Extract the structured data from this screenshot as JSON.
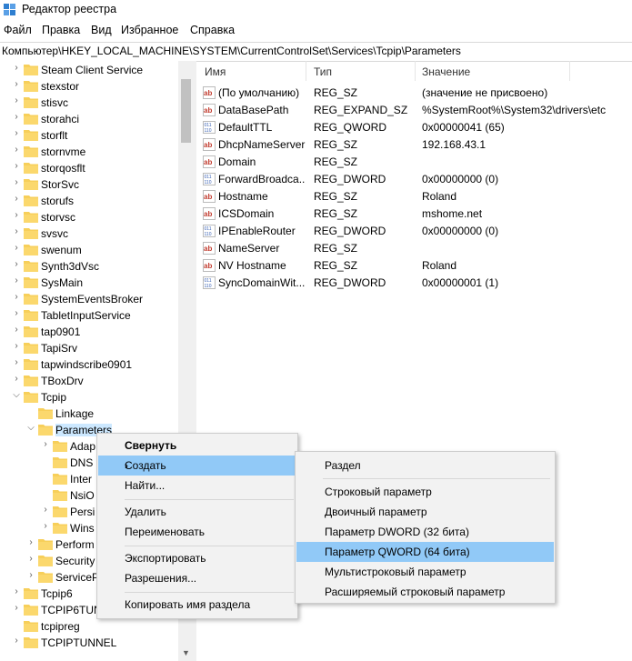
{
  "window": {
    "title": "Редактор реестра"
  },
  "menu": [
    "Файл",
    "Правка",
    "Вид",
    "Избранное",
    "Справка"
  ],
  "address": "Компьютер\\HKEY_LOCAL_MACHINE\\SYSTEM\\CurrentControlSet\\Services\\Tcpip\\Parameters",
  "tree": {
    "items": [
      {
        "label": "Steam Client Service"
      },
      {
        "label": "stexstor"
      },
      {
        "label": "stisvc"
      },
      {
        "label": "storahci"
      },
      {
        "label": "storflt"
      },
      {
        "label": "stornvme"
      },
      {
        "label": "storqosflt"
      },
      {
        "label": "StorSvc"
      },
      {
        "label": "storufs"
      },
      {
        "label": "storvsc"
      },
      {
        "label": "svsvc"
      },
      {
        "label": "swenum"
      },
      {
        "label": "Synth3dVsc"
      },
      {
        "label": "SysMain"
      },
      {
        "label": "SystemEventsBroker"
      },
      {
        "label": "TabletInputService"
      },
      {
        "label": "tap0901"
      },
      {
        "label": "TapiSrv"
      },
      {
        "label": "tapwindscribe0901"
      },
      {
        "label": "TBoxDrv"
      },
      {
        "label": "Tcpip"
      },
      {
        "label": "Linkage"
      },
      {
        "label": "Parameters"
      },
      {
        "label": "Adap"
      },
      {
        "label": "DNS"
      },
      {
        "label": "Inter"
      },
      {
        "label": "NsiO"
      },
      {
        "label": "Persi"
      },
      {
        "label": "Wins"
      },
      {
        "label": "Perform"
      },
      {
        "label": "Security"
      },
      {
        "label": "ServiceP"
      },
      {
        "label": "Tcpip6"
      },
      {
        "label": "TCPIP6TUN"
      },
      {
        "label": "tcpipreg"
      },
      {
        "label": "TCPIPTUNNEL"
      }
    ]
  },
  "list": {
    "headers": [
      "Имя",
      "Тип",
      "Значение"
    ],
    "rows": [
      {
        "name": "(По умолчанию)",
        "type": "REG_SZ",
        "value": "(значение не присвоено)",
        "icon": "string-value-icon"
      },
      {
        "name": "DataBasePath",
        "type": "REG_EXPAND_SZ",
        "value": "%SystemRoot%\\System32\\drivers\\etc",
        "icon": "string-value-icon"
      },
      {
        "name": "DefaultTTL",
        "type": "REG_QWORD",
        "value": "0x00000041 (65)",
        "icon": "binary-value-icon"
      },
      {
        "name": "DhcpNameServer",
        "type": "REG_SZ",
        "value": "192.168.43.1",
        "icon": "string-value-icon"
      },
      {
        "name": "Domain",
        "type": "REG_SZ",
        "value": "",
        "icon": "string-value-icon"
      },
      {
        "name": "ForwardBroadca...",
        "type": "REG_DWORD",
        "value": "0x00000000 (0)",
        "icon": "binary-value-icon"
      },
      {
        "name": "Hostname",
        "type": "REG_SZ",
        "value": "Roland",
        "icon": "string-value-icon"
      },
      {
        "name": "ICSDomain",
        "type": "REG_SZ",
        "value": "mshome.net",
        "icon": "string-value-icon"
      },
      {
        "name": "IPEnableRouter",
        "type": "REG_DWORD",
        "value": "0x00000000 (0)",
        "icon": "binary-value-icon"
      },
      {
        "name": "NameServer",
        "type": "REG_SZ",
        "value": "",
        "icon": "string-value-icon"
      },
      {
        "name": "NV Hostname",
        "type": "REG_SZ",
        "value": "Roland",
        "icon": "string-value-icon"
      },
      {
        "name": "SyncDomainWit...",
        "type": "REG_DWORD",
        "value": "0x00000001 (1)",
        "icon": "binary-value-icon"
      }
    ]
  },
  "context_menu": {
    "items": [
      "Свернуть",
      "Создать",
      "Найти...",
      "Удалить",
      "Переименовать",
      "Экспортировать",
      "Разрешения...",
      "Копировать имя раздела"
    ]
  },
  "submenu": {
    "items": [
      "Раздел",
      "Строковый параметр",
      "Двоичный параметр",
      "Параметр DWORD (32 бита)",
      "Параметр QWORD (64 бита)",
      "Мультистроковый параметр",
      "Расширяемый строковый параметр"
    ]
  },
  "colors": {
    "folder": "#f7cf5a",
    "highlight": "#91c9f7",
    "selected_tree": "#cce8ff",
    "string_icon": "#c23b2e",
    "binary_icon": "#3a62b5"
  }
}
